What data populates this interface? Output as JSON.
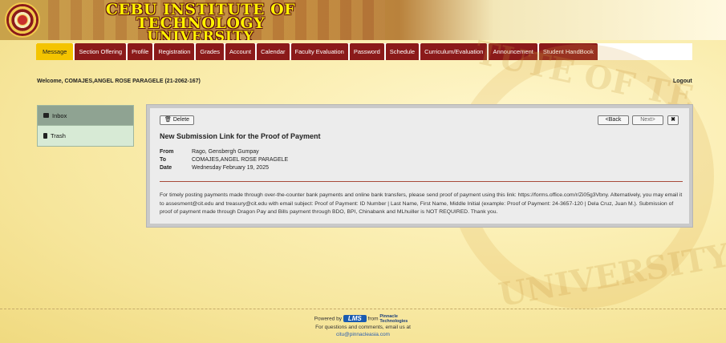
{
  "header": {
    "title_line1": "CEBU INSTITUTE OF TECHNOLOGY",
    "title_line2": "UNIVERSITY"
  },
  "nav": {
    "items": [
      "Message",
      "Section Offering",
      "Profile",
      "Registration",
      "Grades",
      "Account",
      "Calendar",
      "Faculty Evaluation",
      "Password",
      "Schedule",
      "Curriculum/Evaluation",
      "Announcement",
      "Student HandBook"
    ],
    "active": "Message"
  },
  "welcome": "Welcome, COMAJES,ANGEL ROSE PARAGELE (21-2062-167)",
  "logout": "Logout",
  "sidebar": {
    "items": [
      {
        "label": "Inbox",
        "icon": "inbox-icon"
      },
      {
        "label": "Trash",
        "icon": "trash-icon"
      }
    ]
  },
  "toolbar": {
    "delete_label": "Delete",
    "back_label": "<Back",
    "next_label": "Next>",
    "close_label": "✖"
  },
  "message": {
    "subject": "New Submission Link for the Proof of Payment",
    "from_label": "From",
    "from": "Rago, Gensbergh Gumpay",
    "to_label": "To",
    "to": "COMAJES,ANGEL ROSE PARAGELE",
    "date_label": "Date",
    "date": "Wednesday February 19, 2025",
    "body": "For timely posting payments made through over-the-counter bank payments and online bank transfers, please send proof of payment using this link: https://forms.office.com/r/Zi05g3Vbny. Alternatively, you may email it to assesment@cit.edu and treasury@cit.edu with email subject: Proof of Payment: ID Number | Last Name, First Name, Middle Initial (example: Proof of Payment: 24-3657-120 | Dela Cruz, Juan M.). Submission of proof of payment made through Dragon Pay and Bills payment through BDO, BPI, Chinabank and MLhuiller is NOT REQUIRED. Thank you."
  },
  "watermark": {
    "top": "TUTE OF TE",
    "bottom": "UNIVERSITY"
  },
  "footer": {
    "powered": "Powered by",
    "lms": "LMS",
    "from": "from",
    "pinnacle": "Pinnacle Technologies",
    "questions": "For questions and comments, email us at",
    "email": "citu@pinnacleasia.com"
  }
}
